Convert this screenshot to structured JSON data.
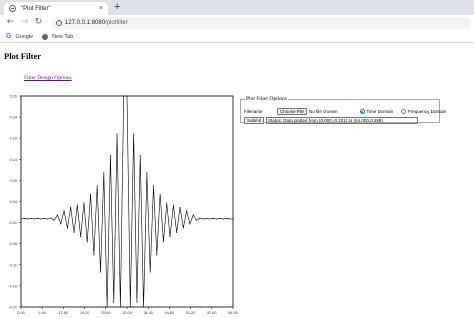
{
  "browser": {
    "tab_title": "\"Plot Filter\"",
    "tab_close": "×",
    "new_tab": "+",
    "url_host": "127.0.0.1:8080",
    "url_path": "/plotfilter",
    "bookmarks": [
      {
        "label": "Google",
        "icon": "google-icon"
      },
      {
        "label": "New Tab",
        "icon": "globe-icon"
      }
    ],
    "nav": {
      "back": "←",
      "forward": "→",
      "reload": "↻"
    }
  },
  "page": {
    "title": "Plot Filter",
    "link": "Filter Design Options"
  },
  "options": {
    "legend": "Plot Filter Options",
    "filename_label": "Filename",
    "choose_file": "Choose File",
    "no_file": "No file chosen",
    "time_domain": "Time Domain",
    "frequency_domain": "Frequency Domain",
    "time_domain_selected": true,
    "submit": "Submit",
    "status": "Status: Data plotted from (0.000,-0.201) to (64.000,0.288)"
  },
  "chart_data": {
    "type": "line",
    "title": "",
    "xlabel": "",
    "ylabel": "",
    "xlim": [
      0,
      64
    ],
    "ylim": [
      -0.201,
      0.288
    ],
    "x_ticks": [
      "0.00",
      "6.40",
      "12.80",
      "19.20",
      "25.60",
      "32.00",
      "38.40",
      "44.80",
      "51.20",
      "57.60",
      "64.00"
    ],
    "y_ticks": [
      "0.29",
      "0.24",
      "0.19",
      "0.14",
      "0.09",
      "0.04",
      "-0.01",
      "-0.06",
      "-0.11",
      "-0.16",
      "-0.21"
    ],
    "x": [
      0,
      1,
      2,
      3,
      4,
      5,
      6,
      7,
      8,
      9,
      10,
      11,
      12,
      13,
      14,
      15,
      16,
      17,
      18,
      19,
      20,
      21,
      22,
      23,
      24,
      25,
      26,
      27,
      28,
      29,
      30,
      31,
      32,
      33,
      34,
      35,
      36,
      37,
      38,
      39,
      40,
      41,
      42,
      43,
      44,
      45,
      46,
      47,
      48,
      49,
      50,
      51,
      52,
      53,
      54,
      55,
      56,
      57,
      58,
      59,
      60,
      61,
      62,
      63,
      64
    ],
    "y": [
      0.003,
      0.004,
      0.003,
      0.004,
      0.003,
      0.004,
      0.003,
      0.004,
      0.003,
      0.005,
      0.0,
      0.012,
      -0.008,
      0.022,
      -0.018,
      0.03,
      -0.028,
      0.035,
      -0.038,
      0.04,
      -0.05,
      0.06,
      -0.08,
      0.08,
      -0.12,
      0.11,
      -0.201,
      0.15,
      -0.19,
      0.2,
      -0.201,
      0.288,
      0.288,
      -0.201,
      0.2,
      -0.19,
      0.15,
      -0.201,
      0.11,
      -0.12,
      0.08,
      -0.08,
      0.06,
      -0.05,
      0.04,
      -0.038,
      0.035,
      -0.028,
      0.03,
      -0.018,
      0.022,
      -0.008,
      0.012,
      0.0,
      0.005,
      0.003,
      0.004,
      0.003,
      0.004,
      0.003,
      0.004,
      0.003,
      0.004,
      0.003,
      0.003
    ],
    "grid": false,
    "legend": "none"
  }
}
